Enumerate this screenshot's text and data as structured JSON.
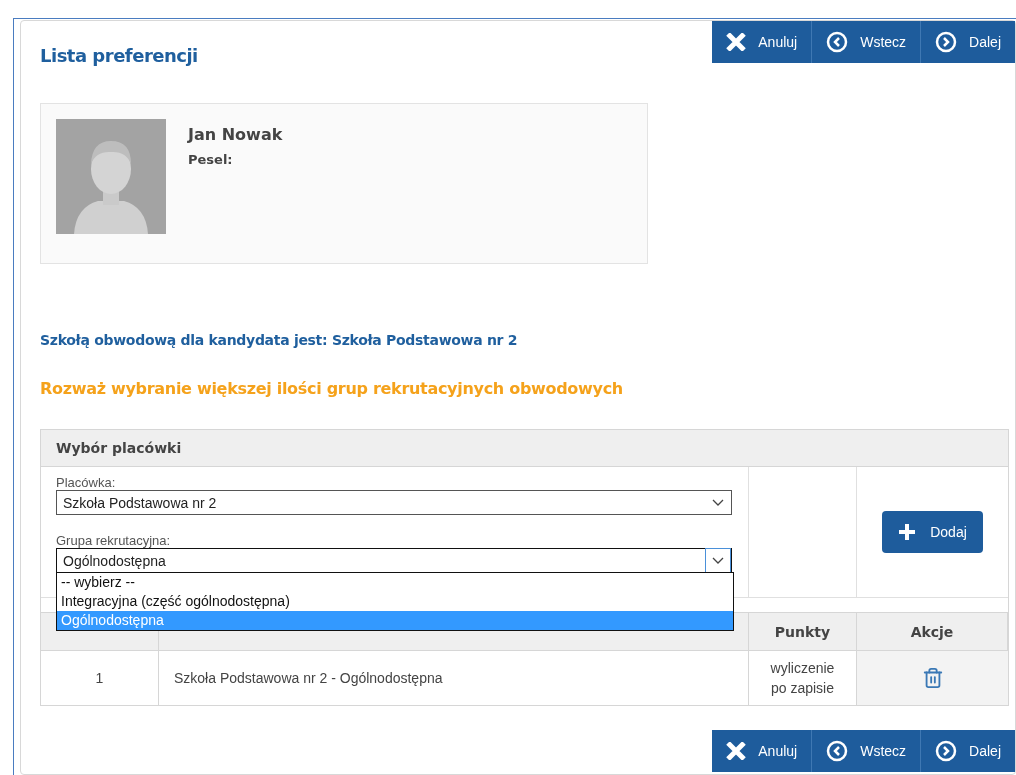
{
  "header": {
    "title": "Lista preferencji"
  },
  "nav_top": [
    {
      "kind": "cancel",
      "label": "Anuluj"
    },
    {
      "kind": "back",
      "label": "Wstecz"
    },
    {
      "kind": "next",
      "label": "Dalej"
    }
  ],
  "candidate": {
    "name": "Jan Nowak",
    "pesel_label": "Pesel:"
  },
  "district_school": "Szkołą obwodową dla kandydata jest: Szkoła Podstawowa nr 2",
  "warning": "Rozważ wybranie większej ilości grup rekrutacyjnych obwodowych",
  "selection": {
    "title": "Wybór placówki",
    "add_button": "Dodaj",
    "fields": [
      {
        "label": "Placówka:",
        "value": "Szkoła Podstawowa nr 2",
        "open": false
      },
      {
        "label": "Grupa rekrutacyjna:",
        "value": "Ogólnodostępna",
        "open": true,
        "options": [
          {
            "label": "-- wybierz --",
            "selected": false
          },
          {
            "label": "Integracyjna (część ogólnodostępna)",
            "selected": false
          },
          {
            "label": "Ogólnodostępna",
            "selected": true
          }
        ]
      }
    ]
  },
  "table": {
    "columns": [
      "Punkty",
      "Akcje"
    ],
    "rows": [
      {
        "number": "1",
        "name": "Szkoła Podstawowa nr 2 - Ogólnodostępna",
        "points": "wyliczenie po zapisie"
      }
    ]
  },
  "nav_bottom": [
    {
      "kind": "cancel",
      "label": "Anuluj"
    },
    {
      "kind": "back",
      "label": "Wstecz"
    },
    {
      "kind": "next",
      "label": "Dalej"
    }
  ]
}
